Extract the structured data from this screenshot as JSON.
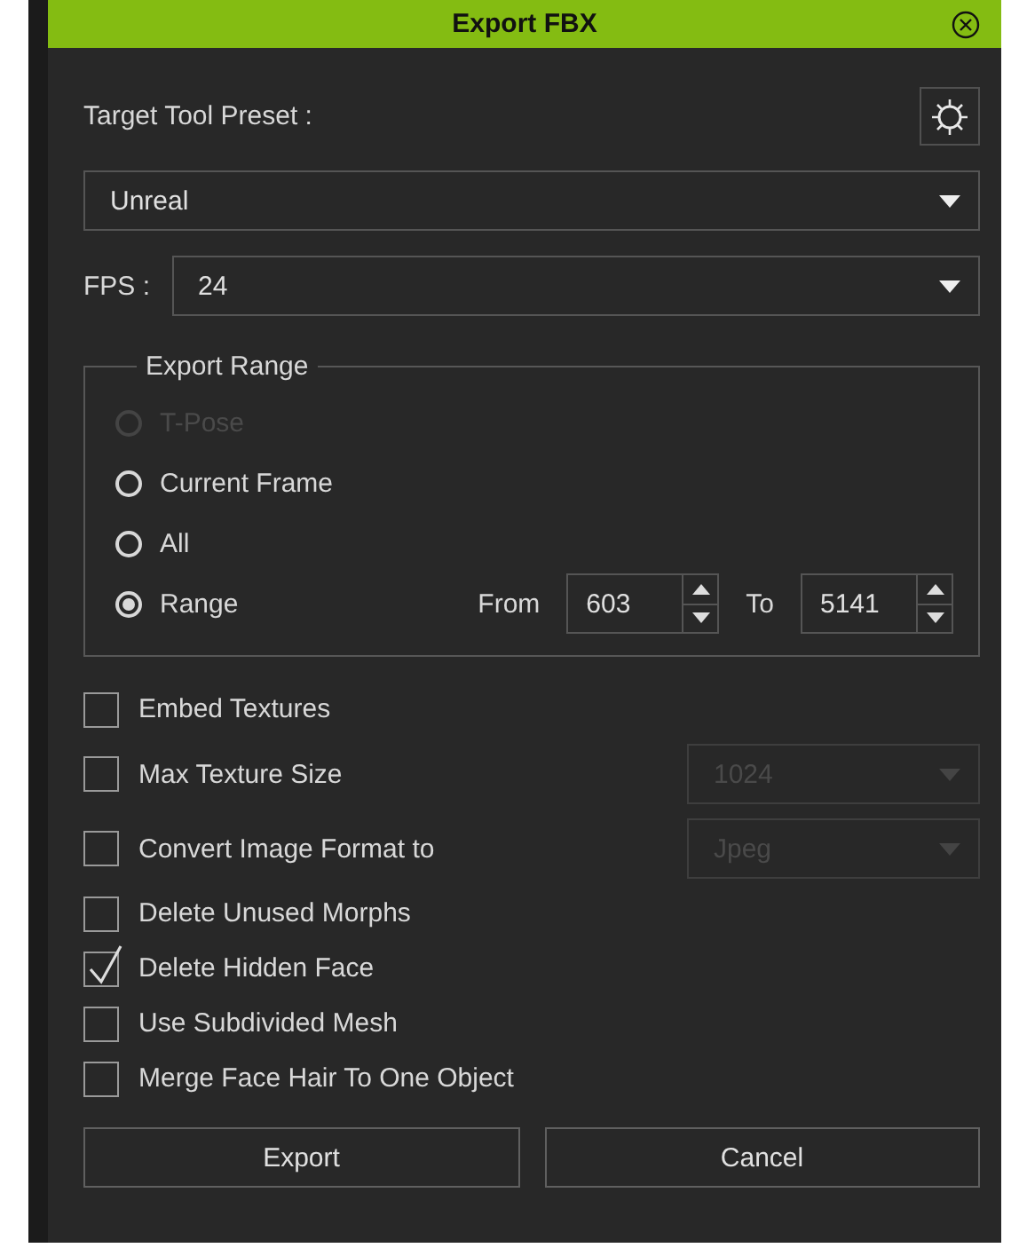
{
  "window": {
    "title": "Export FBX"
  },
  "preset": {
    "label": "Target Tool Preset :",
    "value": "Unreal"
  },
  "fps": {
    "label": "FPS :",
    "value": "24"
  },
  "export_range": {
    "title": "Export Range",
    "options": [
      {
        "label": "T-Pose",
        "selected": false,
        "disabled": true
      },
      {
        "label": "Current Frame",
        "selected": false,
        "disabled": false
      },
      {
        "label": "All",
        "selected": false,
        "disabled": false
      },
      {
        "label": "Range",
        "selected": true,
        "disabled": false
      }
    ],
    "from_label": "From",
    "from_value": "603",
    "to_label": "To",
    "to_value": "5141"
  },
  "options": [
    {
      "kind": "plain",
      "label": "Embed Textures",
      "checked": false
    },
    {
      "kind": "select",
      "label": "Max Texture Size",
      "checked": false,
      "value": "1024",
      "disabled": true
    },
    {
      "kind": "select",
      "label": "Convert Image Format to",
      "checked": false,
      "value": "Jpeg",
      "disabled": true
    },
    {
      "kind": "plain",
      "label": "Delete Unused Morphs",
      "checked": false
    },
    {
      "kind": "plain",
      "label": "Delete Hidden Face",
      "checked": true
    },
    {
      "kind": "plain",
      "label": "Use Subdivided Mesh",
      "checked": false
    },
    {
      "kind": "plain",
      "label": "Merge Face Hair To One Object",
      "checked": false
    }
  ],
  "buttons": [
    "Export",
    "Cancel"
  ]
}
